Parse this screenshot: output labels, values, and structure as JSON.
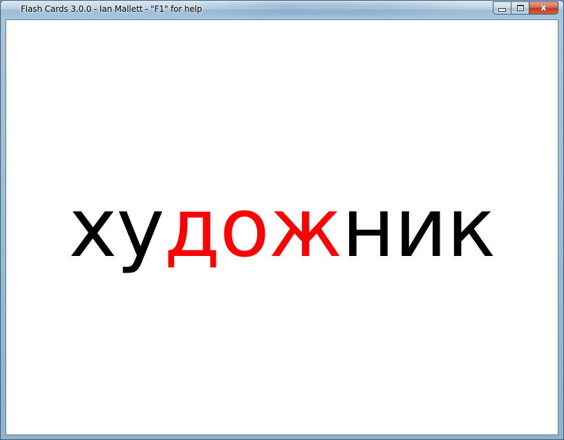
{
  "window": {
    "title": "Flash Cards 3.0.0 - Ian Mallett - \"F1\" for help",
    "controls": {
      "minimize_icon": "minimize-icon",
      "maximize_icon": "maximize-icon",
      "close_icon": "close-icon",
      "close_glyph": "x"
    }
  },
  "card": {
    "segments": [
      {
        "text": "ху",
        "color": "#000000"
      },
      {
        "text": "дож",
        "color": "#ff0000"
      },
      {
        "text": "ник",
        "color": "#000000"
      }
    ]
  },
  "colors": {
    "client_background": "#ffffff",
    "highlight": "#ff0000",
    "text": "#000000"
  }
}
